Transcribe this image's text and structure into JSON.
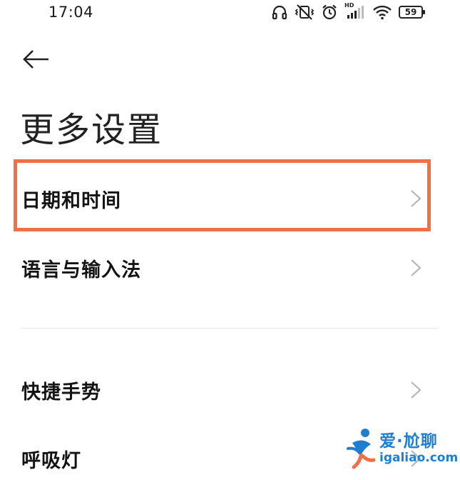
{
  "status_bar": {
    "time": "17:04",
    "battery_level": "59",
    "signal_label": "HD",
    "icons": [
      "headphones-icon",
      "vibrate-off-icon",
      "alarm-icon",
      "cellular-signal-icon",
      "wifi-icon",
      "battery-icon"
    ]
  },
  "header": {
    "back_icon": "arrow-left-icon",
    "title": "更多设置"
  },
  "settings": {
    "items": [
      {
        "label": "日期和时间",
        "icon": "chevron-right-icon",
        "highlighted": true
      },
      {
        "label": "语言与输入法",
        "icon": "chevron-right-icon",
        "highlighted": false
      },
      {
        "label": "快捷手势",
        "icon": "chevron-right-icon",
        "highlighted": false
      },
      {
        "label": "呼吸灯",
        "icon": "chevron-right-icon",
        "highlighted": false
      }
    ]
  },
  "watermark": {
    "brand": "爱·尬聊",
    "url": "igaliao.com"
  },
  "colors": {
    "highlight_border": "#f07048",
    "chevron": "#b5b5b5",
    "watermark": "#1e7fd0",
    "divider": "#e6e6e6"
  }
}
